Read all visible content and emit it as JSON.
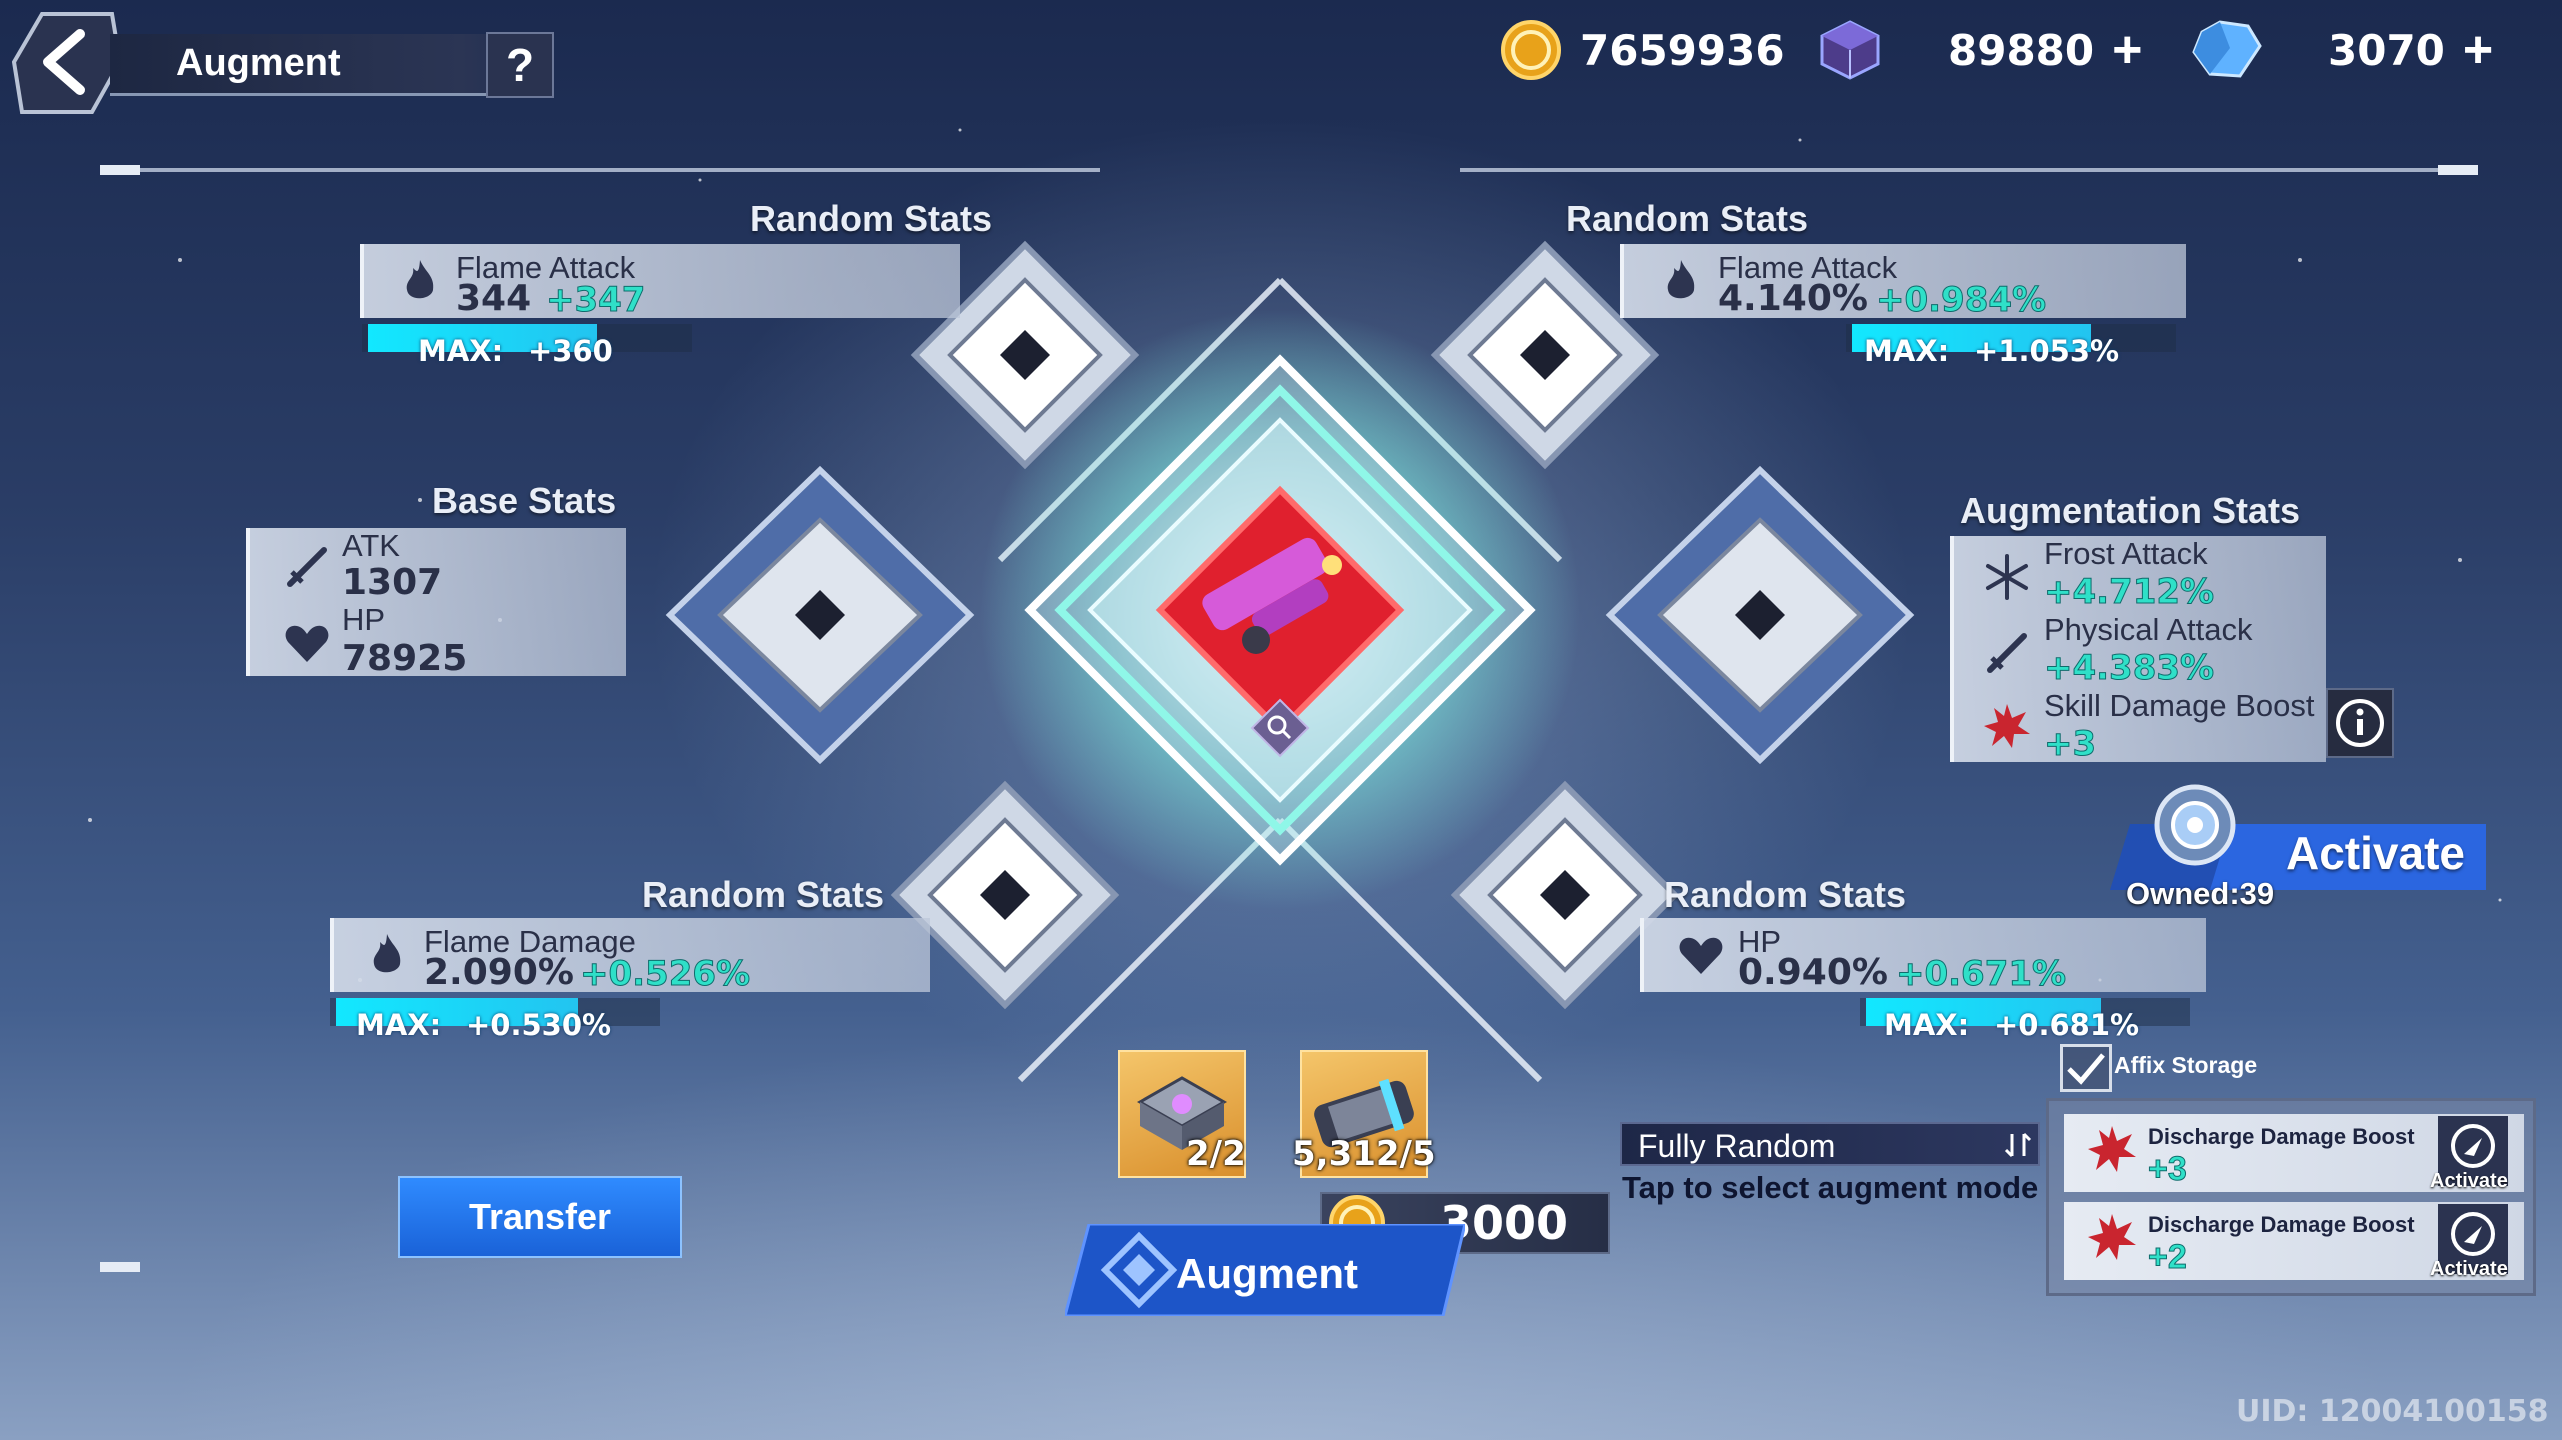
{
  "header": {
    "title": "Augment",
    "help_label": "?",
    "currencies": [
      {
        "icon": "gold-coin-icon",
        "value": "7659936",
        "has_plus": false
      },
      {
        "icon": "purple-cube-icon",
        "value": "89880",
        "has_plus": true
      },
      {
        "icon": "blue-crystal-icon",
        "value": "3070",
        "has_plus": true
      }
    ],
    "plus_label": "+"
  },
  "random_stats": {
    "top_left": {
      "section": "Random Stats",
      "name": "Flame Attack",
      "value": "344",
      "bonus": "+347",
      "max_label": "MAX:",
      "max_value": "+360",
      "max_fill": 0.72
    },
    "top_right": {
      "section": "Random Stats",
      "name": "Flame Attack",
      "value": "4.140%",
      "bonus": "+0.984%",
      "max_label": "MAX:",
      "max_value": "+1.053%",
      "max_fill": 0.75
    },
    "bottom_left": {
      "section": "Random Stats",
      "name": "Flame Damage",
      "value": "2.090%",
      "bonus": "+0.526%",
      "max_label": "MAX:",
      "max_value": "+0.530%",
      "max_fill": 0.76
    },
    "bottom_right": {
      "section": "Random Stats",
      "name": "HP",
      "value": "0.940%",
      "bonus": "+0.671%",
      "max_label": "MAX:",
      "max_value": "+0.681%",
      "max_fill": 0.74
    }
  },
  "base_stats": {
    "section": "Base Stats",
    "items": [
      {
        "name": "ATK",
        "value": "1307",
        "icon": "sword-icon"
      },
      {
        "name": "HP",
        "value": "78925",
        "icon": "heart-icon"
      }
    ]
  },
  "augmentation_stats": {
    "section": "Augmentation Stats",
    "items": [
      {
        "name": "Frost Attack",
        "value": "+4.712%",
        "icon": "snowflake-icon"
      },
      {
        "name": "Physical Attack",
        "value": "+4.383%",
        "icon": "sword-icon"
      },
      {
        "name": "Skill Damage Boost",
        "value": "+3",
        "icon": "explosion-icon"
      }
    ]
  },
  "materials": [
    {
      "count": "2/2"
    },
    {
      "count": "5,312/5"
    }
  ],
  "actions": {
    "transfer_label": "Transfer",
    "augment_label": "Augment",
    "cost": "3000"
  },
  "mode": {
    "current": "Fully Random",
    "hint": "Tap to select augment mode"
  },
  "activate": {
    "label": "Activate",
    "owned": "Owned:39"
  },
  "affix_storage": {
    "title": "Affix Storage",
    "items": [
      {
        "name": "Discharge Damage Boost",
        "value": "+3",
        "action": "Activate"
      },
      {
        "name": "Discharge Damage Boost",
        "value": "+2",
        "action": "Activate"
      }
    ]
  },
  "uid": "UID: 12004100158",
  "colors": {
    "accent_cyan": "#12e8ff",
    "bonus_green": "#2fe0c8",
    "primary_blue": "#1a62d8",
    "core_red": "#e0202e"
  }
}
